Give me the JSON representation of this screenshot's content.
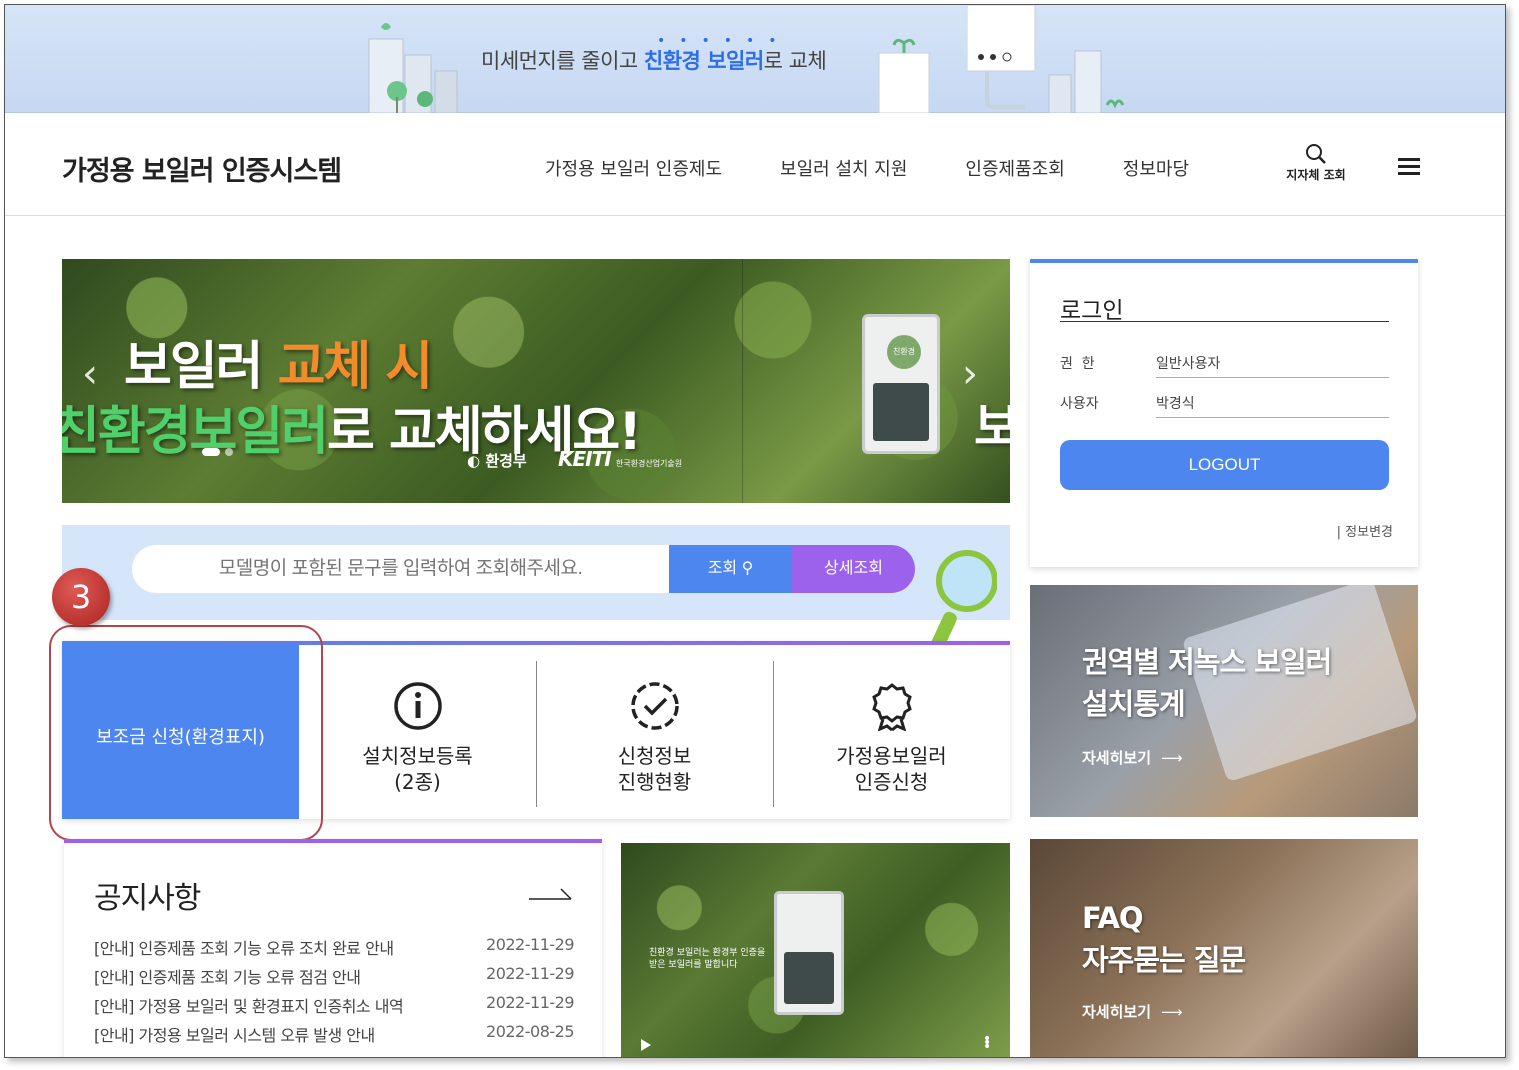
{
  "top_banner": {
    "text_before": "미세먼지를 줄이고 ",
    "highlight": "친환경 보일러",
    "text_after": "로 교체",
    "accent": "#2a6ee8"
  },
  "header": {
    "site_title": "가정용 보일러 인증시스템",
    "nav": [
      "가정용 보일러 인증제도",
      "보일러 설치 지원",
      "인증제품조회",
      "정보마당"
    ],
    "local_search_label": "지자체 조회",
    "search_icon": "search-icon",
    "menu_icon": "hamburger-menu-icon"
  },
  "hero": {
    "line1_white": "보일러 ",
    "line1_orange": "교체 시",
    "line2_green": "친환경보일러",
    "line2_white": "로 교체하세요!",
    "logo1": "환경부",
    "logo2": "KEITI",
    "logo2_sub": "한국환경산업기술원",
    "boiler_badge": "친환경",
    "next_char": "보",
    "arrow_left": "‹",
    "arrow_right": "›",
    "colors": {
      "orange": "#f38b2c",
      "green": "#4fd06a"
    }
  },
  "search": {
    "placeholder": "모델명이 포함된 문구를 입력하여 조회해주세요.",
    "search_btn": "조회",
    "detail_btn": "상세조회",
    "colors": {
      "search": "#4c86ee",
      "detail": "#9d62ec"
    }
  },
  "quick_menu": [
    {
      "label": "보조금 신청(환경표지)",
      "icon": "none"
    },
    {
      "label": "설치정보등록\n(2종)",
      "icon": "info-circle-icon"
    },
    {
      "label": "신청정보\n진행현황",
      "icon": "check-circle-icon"
    },
    {
      "label": "가정용보일러\n인증신청",
      "icon": "award-ribbon-icon"
    }
  ],
  "annotation": {
    "number": "3",
    "color": "#b3464a"
  },
  "login": {
    "title": "로그인",
    "role_label": "권  한",
    "role_value": "일반사용자",
    "user_label": "사용자",
    "user_value": "박경식",
    "logout": "LOGOUT",
    "info_change": "| 정보변경"
  },
  "cards": [
    {
      "title": "권역별 저녹스 보일러\n설치통계",
      "more": "자세히보기",
      "arrow": "⟶"
    },
    {
      "title": "FAQ\n자주묻는 질문",
      "more": "자세히보기",
      "arrow": "⟶"
    }
  ],
  "notice": {
    "title": "공지사항",
    "items": [
      {
        "title": "[안내] 인증제품 조회 기능 오류 조치 완료 안내",
        "date": "2022-11-29"
      },
      {
        "title": "[안내] 인증제품 조회 기능 오류 점검 안내",
        "date": "2022-11-29"
      },
      {
        "title": "[안내] 가정용 보일러 및 환경표지 인증취소 내역",
        "date": "2022-11-29"
      },
      {
        "title": "[안내] 가정용 보일러 시스템 오류 발생 안내",
        "date": "2022-08-25"
      }
    ]
  },
  "video": {
    "caption": "친환경 보일러는 환경부 인증을\n받은 보일러를 말합니다"
  }
}
